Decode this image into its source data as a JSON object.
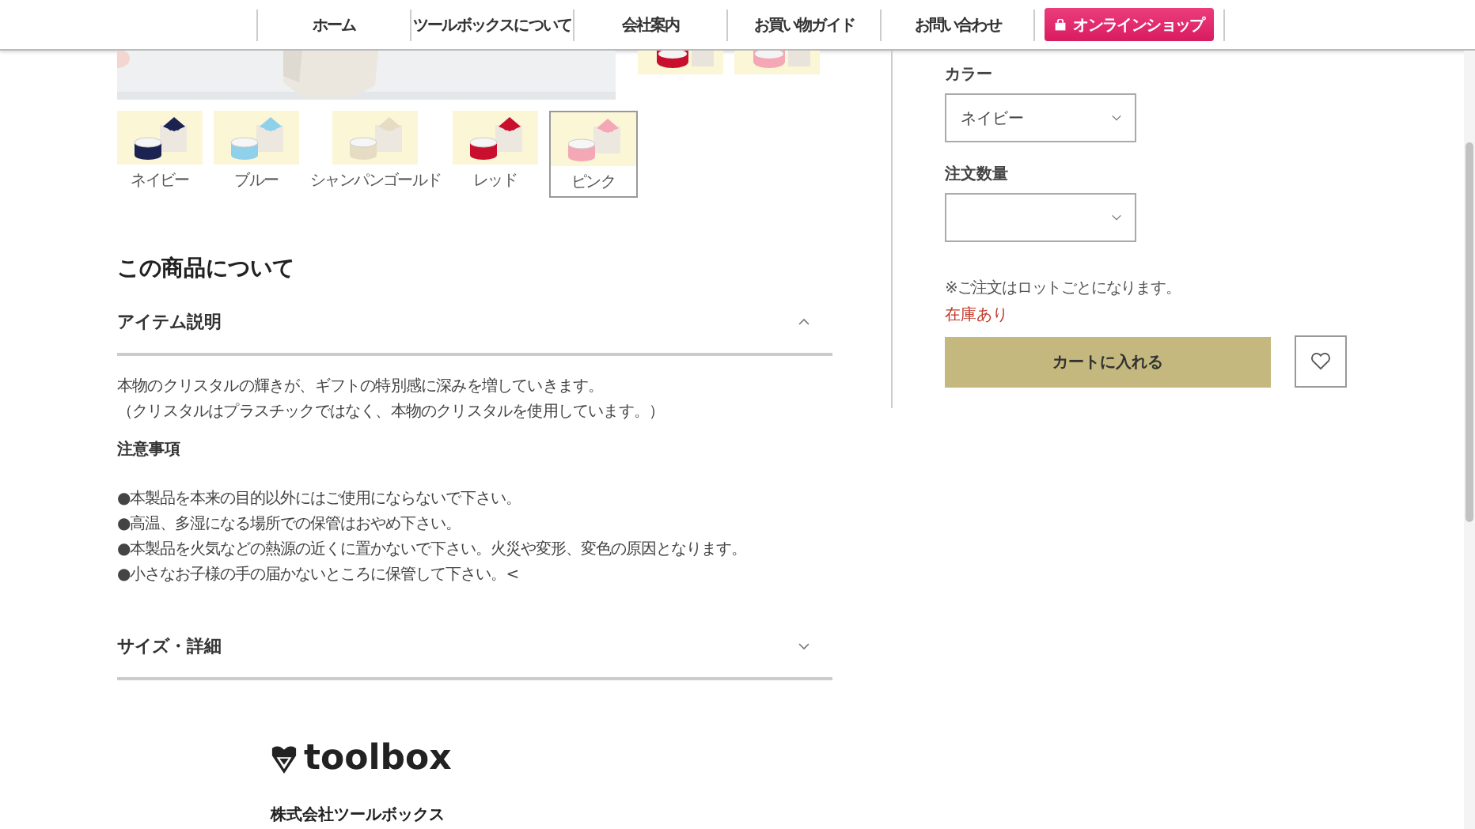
{
  "nav": {
    "items": [
      {
        "label": "ホーム",
        "kind": "link"
      },
      {
        "label": "ツールボックスについて",
        "kind": "link"
      },
      {
        "label": "会社案内",
        "kind": "link"
      },
      {
        "label": "お買い物ガイド",
        "kind": "link"
      },
      {
        "label": "お問い合わせ",
        "kind": "link"
      },
      {
        "label": "オンラインショップ",
        "kind": "shop"
      }
    ]
  },
  "gallery": {
    "side_thumbs": [
      {
        "color": "#c8102e"
      },
      {
        "color": "#f4a7b5"
      }
    ],
    "swatches": [
      {
        "label": "ネイビー",
        "color": "#1c2350",
        "selected": false
      },
      {
        "label": "ブルー",
        "color": "#8fd0ea",
        "selected": false
      },
      {
        "label": "シャンパンゴールド",
        "color": "#e6dcc4",
        "selected": false
      },
      {
        "label": "レッド",
        "color": "#c8102e",
        "selected": false
      },
      {
        "label": "ピンク",
        "color": "#f4a7b5",
        "selected": true
      }
    ]
  },
  "about": {
    "title": "この商品について",
    "sections": [
      {
        "title": "アイテム説明",
        "expanded": true,
        "paragraphs": [
          "本物のクリスタルの輝きが、ギフトの特別感に深みを増していきます。",
          "（クリスタルはプラスチックではなく、本物のクリスタルを使用しています。）"
        ],
        "notes_heading": "注意事項",
        "notes": [
          "●本製品を本来の目的以外にはご使用にならないで下さい。",
          "●高温、多湿になる場所での保管はおやめ下さい。",
          "●本製品を火気などの熱源の近くに置かないで下さい。火災や変形、変色の原因となります。",
          "●小さなお子様の手の届かないところに保管して下さい。<"
        ]
      },
      {
        "title": "サイズ・詳細",
        "expanded": false
      }
    ]
  },
  "order": {
    "color_label": "カラー",
    "color_value": "ネイビー",
    "qty_label": "注文数量",
    "note": "※ご注文はロットごとになります。",
    "stock": "在庫あり",
    "cart_button": "カートに入れる"
  },
  "footer": {
    "logo": "toolbox",
    "company": "株式会社ツールボックス"
  }
}
